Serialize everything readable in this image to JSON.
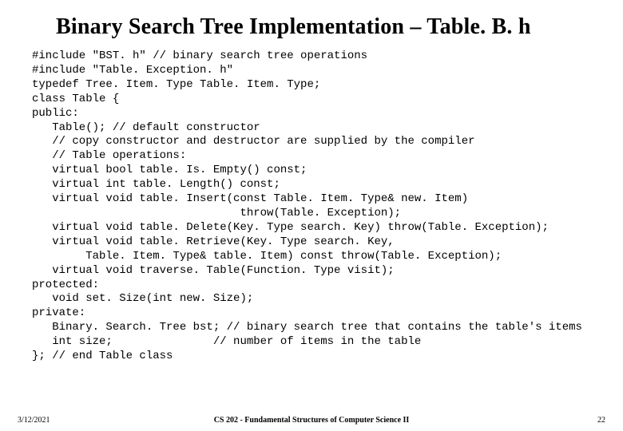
{
  "title": "Binary Search Tree Implementation – Table. B. h",
  "code_lines": [
    "#include \"BST. h\" // binary search tree operations",
    "#include \"Table. Exception. h\"",
    "typedef Tree. Item. Type Table. Item. Type;",
    "class Table {",
    "public:",
    "   Table(); // default constructor",
    "   // copy constructor and destructor are supplied by the compiler",
    "   // Table operations:",
    "   virtual bool table. Is. Empty() const;",
    "   virtual int table. Length() const;",
    "   virtual void table. Insert(const Table. Item. Type& new. Item)",
    "                               throw(Table. Exception);",
    "   virtual void table. Delete(Key. Type search. Key) throw(Table. Exception);",
    "   virtual void table. Retrieve(Key. Type search. Key,",
    "        Table. Item. Type& table. Item) const throw(Table. Exception);",
    "   virtual void traverse. Table(Function. Type visit);",
    "protected:",
    "   void set. Size(int new. Size);",
    "private:",
    "   Binary. Search. Tree bst; // binary search tree that contains the table's items",
    "   int size;               // number of items in the table",
    "}; // end Table class"
  ],
  "footer": {
    "date": "3/12/2021",
    "course": "CS 202 - Fundamental Structures of Computer Science II",
    "page": "22"
  }
}
